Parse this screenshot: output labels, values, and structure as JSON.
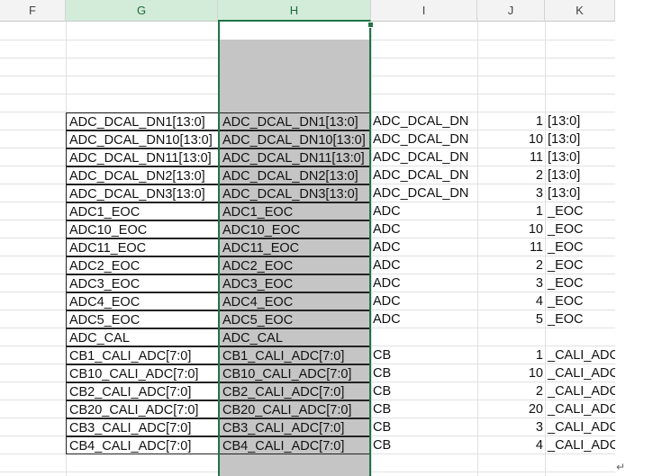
{
  "columns": {
    "F": "F",
    "G": "G",
    "H": "H",
    "I": "I",
    "J": "J",
    "K": "K"
  },
  "rows": [
    {
      "g": "ADC_DCAL_DN1[13:0]",
      "h": "ADC_DCAL_DN1[13:0]",
      "i": "ADC_DCAL_DN",
      "j": "1",
      "k": "[13:0]"
    },
    {
      "g": "ADC_DCAL_DN10[13:0]",
      "h": "ADC_DCAL_DN10[13:0]",
      "i": "ADC_DCAL_DN",
      "j": "10",
      "k": "[13:0]"
    },
    {
      "g": "ADC_DCAL_DN11[13:0]",
      "h": "ADC_DCAL_DN11[13:0]",
      "i": "ADC_DCAL_DN",
      "j": "11",
      "k": "[13:0]"
    },
    {
      "g": "ADC_DCAL_DN2[13:0]",
      "h": "ADC_DCAL_DN2[13:0]",
      "i": "ADC_DCAL_DN",
      "j": "2",
      "k": "[13:0]"
    },
    {
      "g": "ADC_DCAL_DN3[13:0]",
      "h": "ADC_DCAL_DN3[13:0]",
      "i": "ADC_DCAL_DN",
      "j": "3",
      "k": "[13:0]"
    },
    {
      "g": "ADC1_EOC",
      "h": "ADC1_EOC",
      "i": "ADC",
      "j": "1",
      "k": "_EOC"
    },
    {
      "g": "ADC10_EOC",
      "h": "ADC10_EOC",
      "i": "ADC",
      "j": "10",
      "k": "_EOC"
    },
    {
      "g": "ADC11_EOC",
      "h": "ADC11_EOC",
      "i": "ADC",
      "j": "11",
      "k": "_EOC"
    },
    {
      "g": "ADC2_EOC",
      "h": "ADC2_EOC",
      "i": "ADC",
      "j": "2",
      "k": "_EOC"
    },
    {
      "g": "ADC3_EOC",
      "h": "ADC3_EOC",
      "i": "ADC",
      "j": "3",
      "k": "_EOC"
    },
    {
      "g": "ADC4_EOC",
      "h": "ADC4_EOC",
      "i": "ADC",
      "j": "4",
      "k": "_EOC"
    },
    {
      "g": "ADC5_EOC",
      "h": "ADC5_EOC",
      "i": "ADC",
      "j": "5",
      "k": "_EOC"
    },
    {
      "g": "ADC_CAL",
      "h": "ADC_CAL",
      "i": "",
      "j": "",
      "k": ""
    },
    {
      "g": "CB1_CALI_ADC[7:0]",
      "h": "CB1_CALI_ADC[7:0]",
      "i": "CB",
      "j": "1",
      "k": "_CALI_ADC"
    },
    {
      "g": "CB10_CALI_ADC[7:0]",
      "h": "CB10_CALI_ADC[7:0]",
      "i": "CB",
      "j": "10",
      "k": "_CALI_ADC"
    },
    {
      "g": "CB2_CALI_ADC[7:0]",
      "h": "CB2_CALI_ADC[7:0]",
      "i": "CB",
      "j": "2",
      "k": "_CALI_ADC"
    },
    {
      "g": "CB20_CALI_ADC[7:0]",
      "h": "CB20_CALI_ADC[7:0]",
      "i": "CB",
      "j": "20",
      "k": "_CALI_ADC"
    },
    {
      "g": "CB3_CALI_ADC[7:0]",
      "h": "CB3_CALI_ADC[7:0]",
      "i": "CB",
      "j": "3",
      "k": "_CALI_ADC"
    },
    {
      "g": "CB4_CALI_ADC[7:0]",
      "h": "CB4_CALI_ADC[7:0]",
      "i": "CB",
      "j": "4",
      "k": "_CALI_ADC"
    }
  ],
  "paragraph_mark": "↵",
  "colors": {
    "selection_green": "#217346",
    "header_selected_bg": "#d3ecd9",
    "gray_fill": "#c5c5c5"
  }
}
